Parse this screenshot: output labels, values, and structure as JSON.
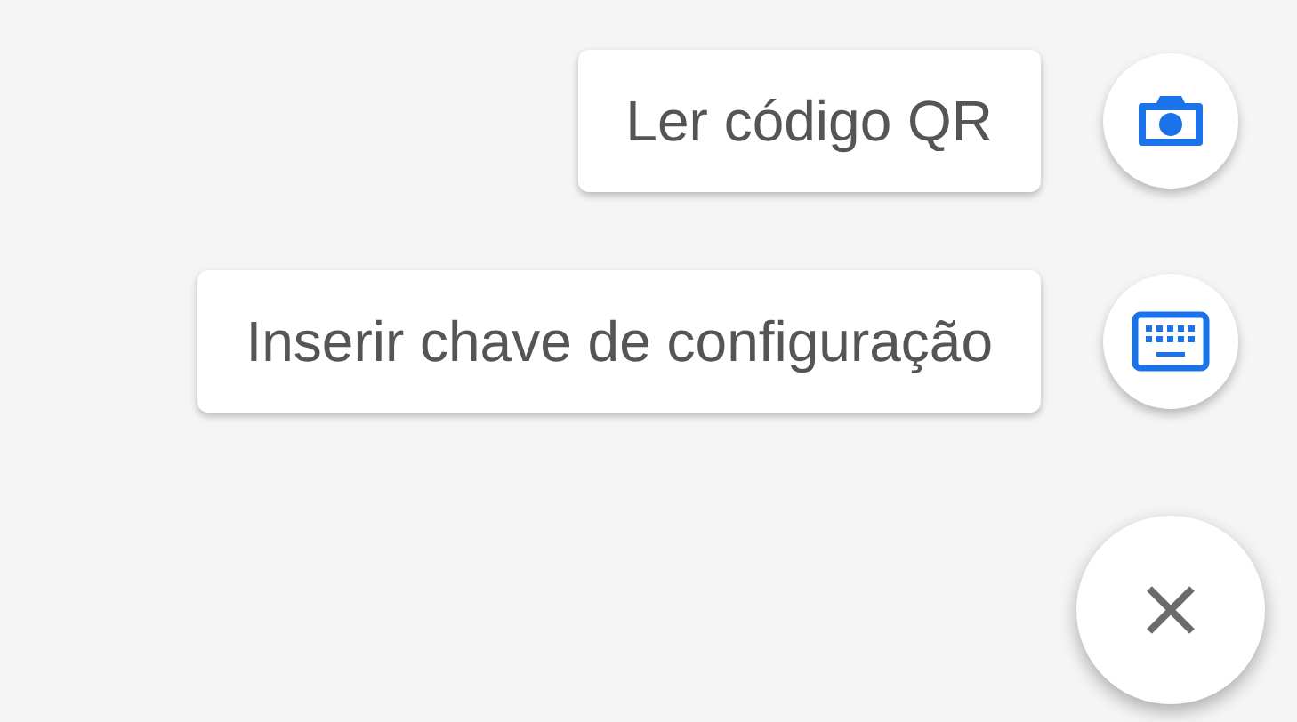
{
  "actions": [
    {
      "kind": "camera",
      "label": "Ler código QR"
    },
    {
      "kind": "keyboard",
      "label": "Inserir chave de configuração"
    }
  ]
}
